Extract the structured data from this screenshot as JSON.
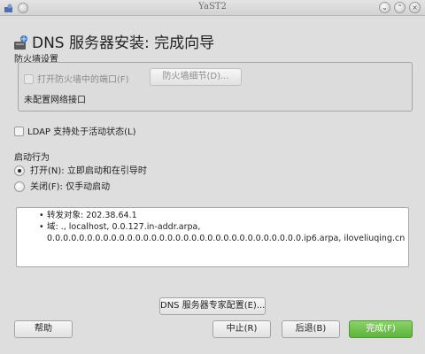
{
  "window": {
    "title": "YaST2"
  },
  "header": {
    "title": "DNS 服务器安装: 完成向导"
  },
  "firewall": {
    "section_label": "防火墙设置",
    "open_port_label": "打开防火墙中的端口(F)",
    "details_button": "防火墙细节(D)...",
    "interfaces_text": "未配置网络接口"
  },
  "ldap": {
    "label": "LDAP 支持处于活动状态(L)",
    "checked": false
  },
  "startup": {
    "label": "启动行为",
    "options": [
      {
        "label": "打开(N): 立即启动和在引导时",
        "selected": true
      },
      {
        "label": "关闭(F): 仅手动启动",
        "selected": false
      }
    ]
  },
  "summary": {
    "forwarders": "转发对象: 202.38.64.1",
    "domains_line1": "域: ., localhost, 0.0.127.in-addr.arpa,",
    "domains_line2": "0.0.0.0.0.0.0.0.0.0.0.0.0.0.0.0.0.0.0.0.0.0.0.0.0.0.0.0.0.0.0.0.ip6.arpa, iloveliuqing.cn"
  },
  "buttons": {
    "expert": "DNS 服务器专家配置(E)...",
    "help": "帮助",
    "abort": "中止(R)",
    "back": "后退(B)",
    "finish": "完成(F)"
  },
  "colors": {
    "finish_button": "#6cbf48",
    "background": "#dedede"
  }
}
